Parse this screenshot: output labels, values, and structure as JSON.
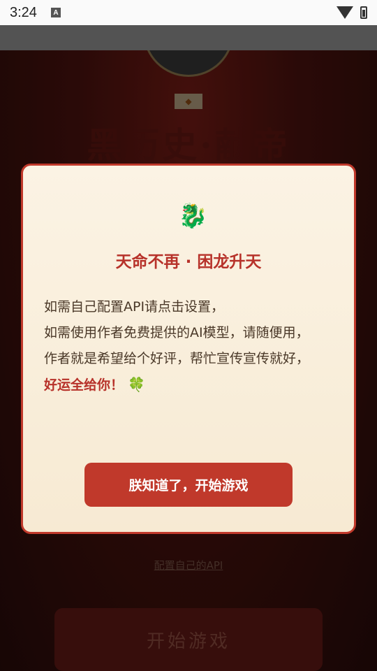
{
  "status_bar": {
    "time": "3:24",
    "notification_icon": "A"
  },
  "background": {
    "title": "黑历史·献帝",
    "config_link": "配置自己的API",
    "start_button": "开始游戏"
  },
  "modal": {
    "icon": "dragon-icon",
    "title": "天命不再 · 困龙升天",
    "lines": [
      "如需自己配置API请点击设置，",
      "如需使用作者免费提供的AI模型，请随便用，",
      "作者就是希望给个好评，帮忙宣传宣传就好，"
    ],
    "lucky_text": "好运全给你！",
    "confirm_label": "朕知道了，开始游戏"
  },
  "colors": {
    "accent": "#c0392b",
    "modal_bg": "#fbf3e4",
    "body_text": "#4a3828"
  }
}
